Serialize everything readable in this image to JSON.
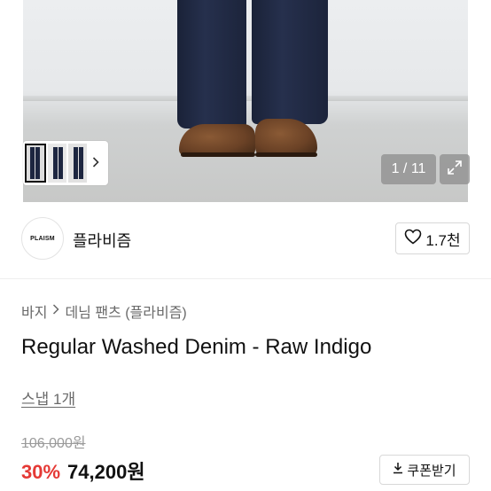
{
  "gallery": {
    "counter": "1 / 11",
    "total_images": 11,
    "current_index": 1
  },
  "seller": {
    "logo_text": "PLAISM",
    "name": "플라비즘",
    "likes_label": "1.7천"
  },
  "breadcrumb": {
    "category": "바지",
    "subcategory": "데님 팬츠 (플라비즘)"
  },
  "product": {
    "title": "Regular Washed Denim - Raw Indigo",
    "snap_label": "스냅 1개",
    "original_price": "106,000원",
    "discount": "30%",
    "price": "74,200원",
    "coupon_label": "쿠폰받기"
  },
  "colors": {
    "discount": "#e53935",
    "text": "#111111",
    "muted": "#6a6a6a"
  },
  "icons": {
    "like": "heart-icon",
    "coupon": "download-icon",
    "expand": "expand-icon",
    "thumb_next": "chevron-right-icon",
    "breadcrumb_sep": "chevron-right-icon"
  }
}
